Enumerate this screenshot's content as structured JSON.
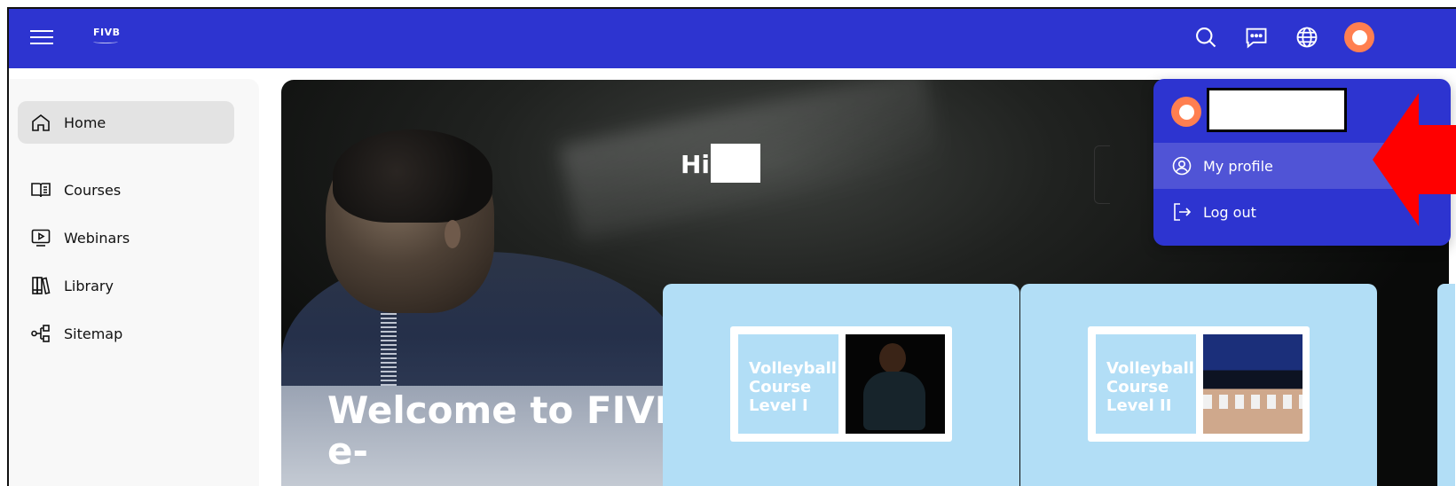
{
  "colors": {
    "brand": "#2d34d0",
    "avatar": "#ff7f50",
    "card": "#b2def6",
    "annotation_arrow": "#ff0000"
  },
  "header": {
    "logo_text": "FIVB",
    "icons": [
      "hamburger-menu-icon",
      "search-icon",
      "chat-icon",
      "globe-icon",
      "avatar"
    ]
  },
  "sidebar": {
    "items": [
      {
        "label": "Home",
        "icon": "home-icon",
        "active": true
      },
      {
        "label": "Courses",
        "icon": "book-icon",
        "active": false
      },
      {
        "label": "Webinars",
        "icon": "video-icon",
        "active": false
      },
      {
        "label": "Library",
        "icon": "library-icon",
        "active": false
      },
      {
        "label": "Sitemap",
        "icon": "sitemap-icon",
        "active": false
      }
    ]
  },
  "hero": {
    "greeting": "Hi,",
    "title": "Welcome to FIVB e-"
  },
  "courses": [
    {
      "title": "Volleyball Course Level I"
    },
    {
      "title": "Volleyball Course Level II"
    }
  ],
  "user_menu": {
    "items": [
      {
        "label": "My profile",
        "icon": "user-circle-icon"
      },
      {
        "label": "Log out",
        "icon": "logout-icon"
      }
    ]
  }
}
